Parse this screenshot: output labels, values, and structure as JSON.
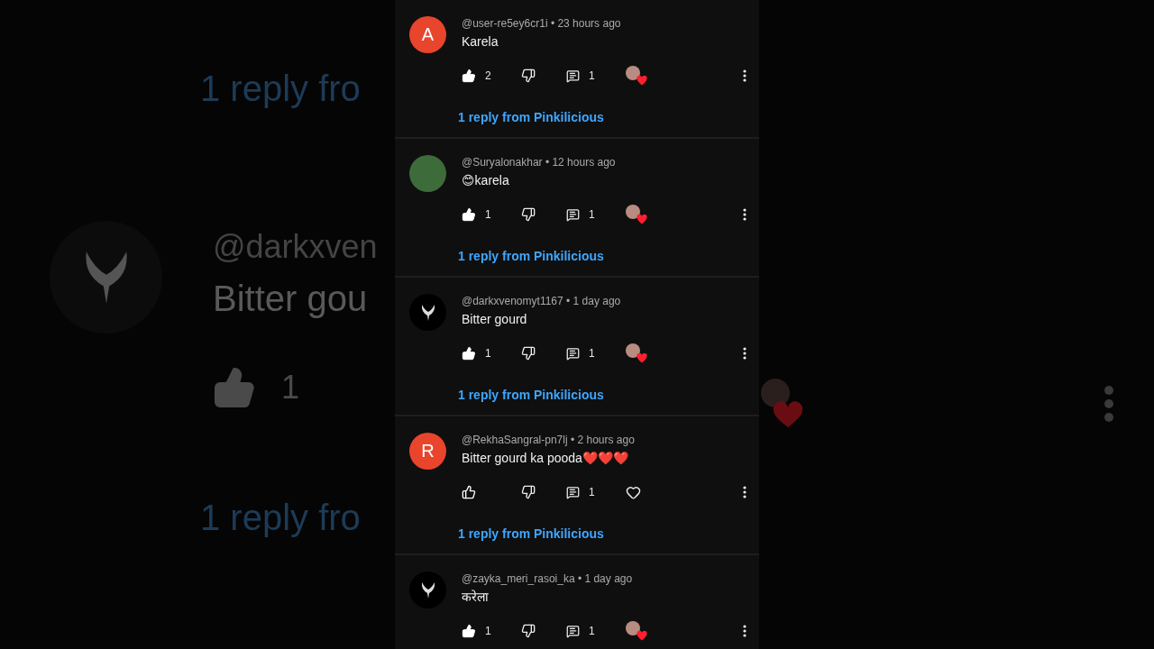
{
  "backdrop": {
    "reply_top": "1 reply fro",
    "handle": "@darkxven",
    "text": "Bitter gou",
    "like_count": "1",
    "reply_bottom": "1 reply fro"
  },
  "comments": [
    {
      "avatar": {
        "kind": "letter",
        "letter": "A"
      },
      "meta": "@user-re5ey6cr1i • 23 hours ago",
      "text": "Karela",
      "liked": true,
      "like_count": "2",
      "reply_count": "1",
      "hearted": true,
      "replies_link": "1 reply from Pinkilicious"
    },
    {
      "avatar": {
        "kind": "photo"
      },
      "meta": "@Suryalonakhar • 12 hours ago",
      "text": "😊karela",
      "liked": true,
      "like_count": "1",
      "reply_count": "1",
      "hearted": true,
      "replies_link": "1 reply from Pinkilicious"
    },
    {
      "avatar": {
        "kind": "logo"
      },
      "meta": "@darkxvenomyt1167 • 1 day ago",
      "text": "Bitter gourd",
      "liked": true,
      "like_count": "1",
      "reply_count": "1",
      "hearted": true,
      "replies_link": "1 reply from Pinkilicious"
    },
    {
      "avatar": {
        "kind": "letter",
        "letter": "R"
      },
      "meta": "@RekhaSangral-pn7lj • 2 hours ago",
      "text": "Bitter gourd ka pooda❤️❤️❤️",
      "liked": false,
      "reply_count": "1",
      "hearted": false,
      "replies_link": "1 reply from Pinkilicious"
    },
    {
      "avatar": {
        "kind": "logo"
      },
      "meta": "@zayka_meri_rasoi_ka • 1 day ago",
      "text": "करेला",
      "liked": true,
      "like_count": "1",
      "reply_count": "1",
      "hearted": true
    }
  ]
}
